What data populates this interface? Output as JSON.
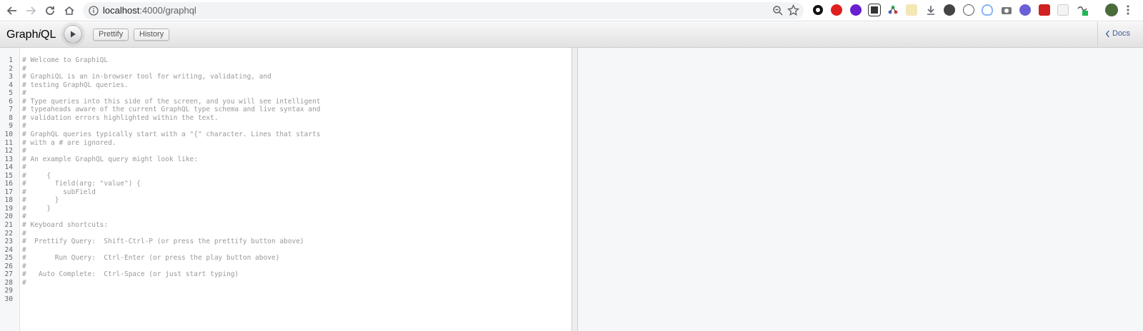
{
  "browser": {
    "url_host": "localhost",
    "url_path": ":4000/graphql",
    "extensions": [
      "github-icon",
      "red-shield-icon",
      "purple-circle-icon",
      "qr-icon",
      "graph-icon",
      "puzzle-icon",
      "download-icon",
      "dark-circle-icon",
      "bracket-icon",
      "shield-outline-icon",
      "camera-icon",
      "r-badge-icon",
      "red-badge-icon",
      "tex-icon",
      "link-badge-icon"
    ]
  },
  "graphiql": {
    "title_prefix": "Graph",
    "title_italic": "i",
    "title_suffix": "QL",
    "prettify_label": "Prettify",
    "history_label": "History",
    "docs_label": "Docs"
  },
  "editor": {
    "line_numbers": [
      "1",
      "2",
      "3",
      "4",
      "5",
      "6",
      "7",
      "8",
      "9",
      "10",
      "11",
      "12",
      "13",
      "14",
      "15",
      "16",
      "17",
      "18",
      "19",
      "20",
      "21",
      "22",
      "23",
      "24",
      "25",
      "26",
      "27",
      "28",
      "29",
      "30"
    ],
    "lines": [
      "# Welcome to GraphiQL",
      "#",
      "# GraphiQL is an in-browser tool for writing, validating, and",
      "# testing GraphQL queries.",
      "#",
      "# Type queries into this side of the screen, and you will see intelligent",
      "# typeaheads aware of the current GraphQL type schema and live syntax and",
      "# validation errors highlighted within the text.",
      "#",
      "# GraphQL queries typically start with a \"{\" character. Lines that starts",
      "# with a # are ignored.",
      "#",
      "# An example GraphQL query might look like:",
      "#",
      "#     {",
      "#       field(arg: \"value\") {",
      "#         subField",
      "#       }",
      "#     }",
      "#",
      "# Keyboard shortcuts:",
      "#",
      "#  Prettify Query:  Shift-Ctrl-P (or press the prettify button above)",
      "#",
      "#       Run Query:  Ctrl-Enter (or press the play button above)",
      "#",
      "#   Auto Complete:  Ctrl-Space (or just start typing)",
      "#",
      "",
      ""
    ]
  }
}
